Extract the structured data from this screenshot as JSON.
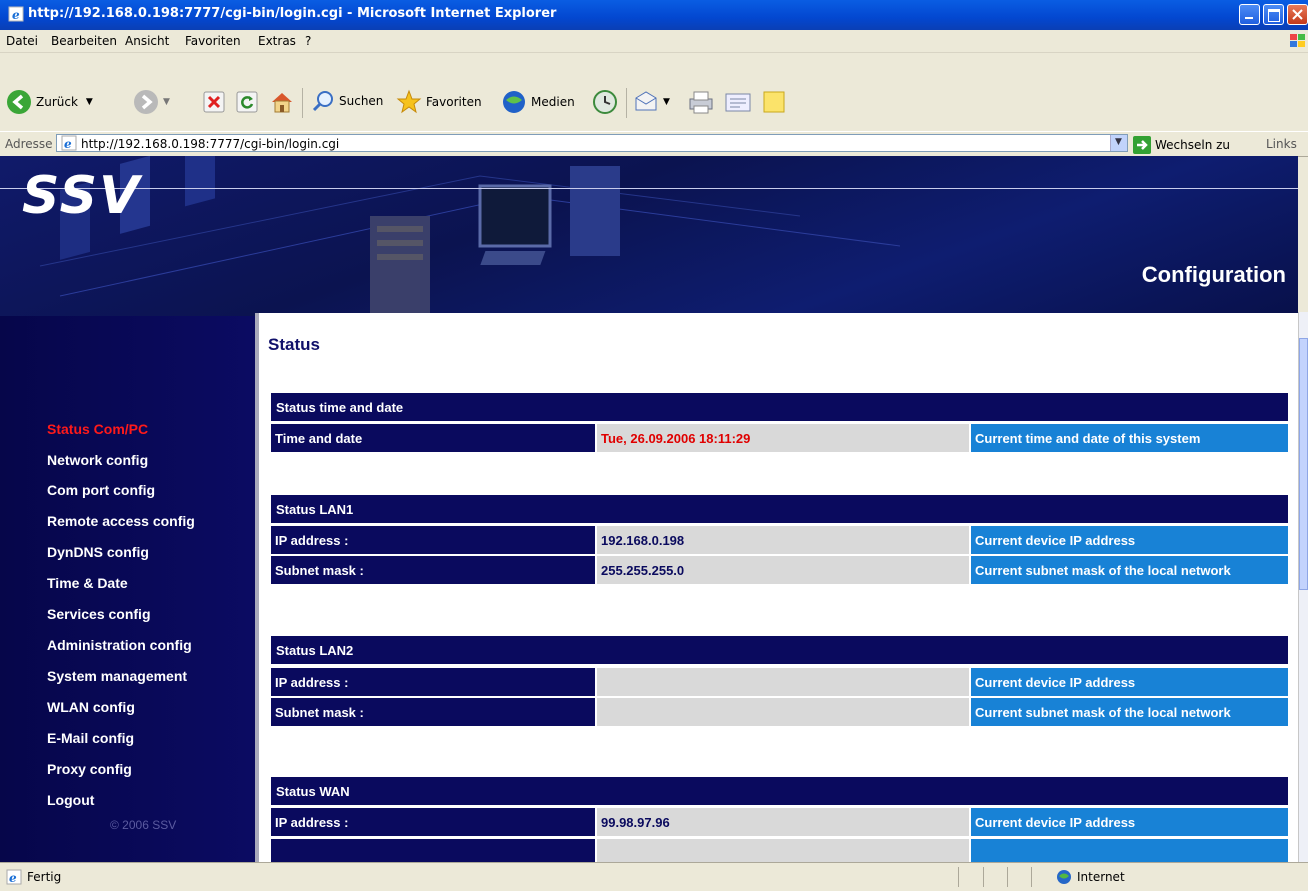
{
  "window": {
    "title": "http://192.168.0.198:7777/cgi-bin/login.cgi - Microsoft Internet Explorer"
  },
  "menu": [
    "Datei",
    "Bearbeiten",
    "Ansicht",
    "Favoriten",
    "Extras",
    "?"
  ],
  "toolbar": {
    "back": "Zurück",
    "search": "Suchen",
    "favorites": "Favoriten",
    "media": "Medien"
  },
  "address": {
    "label": "Adresse",
    "url": "http://192.168.0.198:7777/cgi-bin/login.cgi",
    "go": "Wechseln zu",
    "links": "Links"
  },
  "banner": {
    "logo": "SSV",
    "heading": "Configuration"
  },
  "sidebar": {
    "items": [
      {
        "label": "Status Com/PC",
        "active": true
      },
      {
        "label": "Network config"
      },
      {
        "label": "Com port config"
      },
      {
        "label": "Remote access config"
      },
      {
        "label": "DynDNS config"
      },
      {
        "label": "Time & Date"
      },
      {
        "label": "Services config"
      },
      {
        "label": "Administration config"
      },
      {
        "label": "System management"
      },
      {
        "label": "WLAN config"
      },
      {
        "label": "E-Mail config"
      },
      {
        "label": "Proxy config"
      },
      {
        "label": "Logout"
      }
    ],
    "copyright": "© 2006 SSV"
  },
  "main": {
    "title": "Status",
    "sections": [
      {
        "title": "Status time and date",
        "rows": [
          {
            "label": "Time and date",
            "value": "Tue, 26.09.2006 18:11:29",
            "desc": "Current time and date of this system"
          }
        ]
      },
      {
        "title": "Status LAN1",
        "rows": [
          {
            "label": "IP address :",
            "value": "192.168.0.198",
            "desc": "Current device IP address"
          },
          {
            "label": "Subnet mask :",
            "value": "255.255.255.0",
            "desc": "Current subnet mask of the local network"
          }
        ]
      },
      {
        "title": "Status LAN2",
        "rows": [
          {
            "label": "IP address :",
            "value": "",
            "desc": "Current device IP address"
          },
          {
            "label": "Subnet mask :",
            "value": "",
            "desc": "Current subnet mask of the local network"
          }
        ]
      },
      {
        "title": "Status WAN",
        "rows": [
          {
            "label": "IP address :",
            "value": "99.98.97.96",
            "desc": "Current device IP address"
          }
        ]
      }
    ]
  },
  "status": {
    "text": "Fertig",
    "zone": "Internet"
  },
  "colors": {
    "nav_active": "#ff1a1a",
    "header_bg": "#0a0a5e",
    "desc_bg": "#1882d6",
    "value_bg": "#d9d9d9",
    "value_red": "#e00000"
  }
}
